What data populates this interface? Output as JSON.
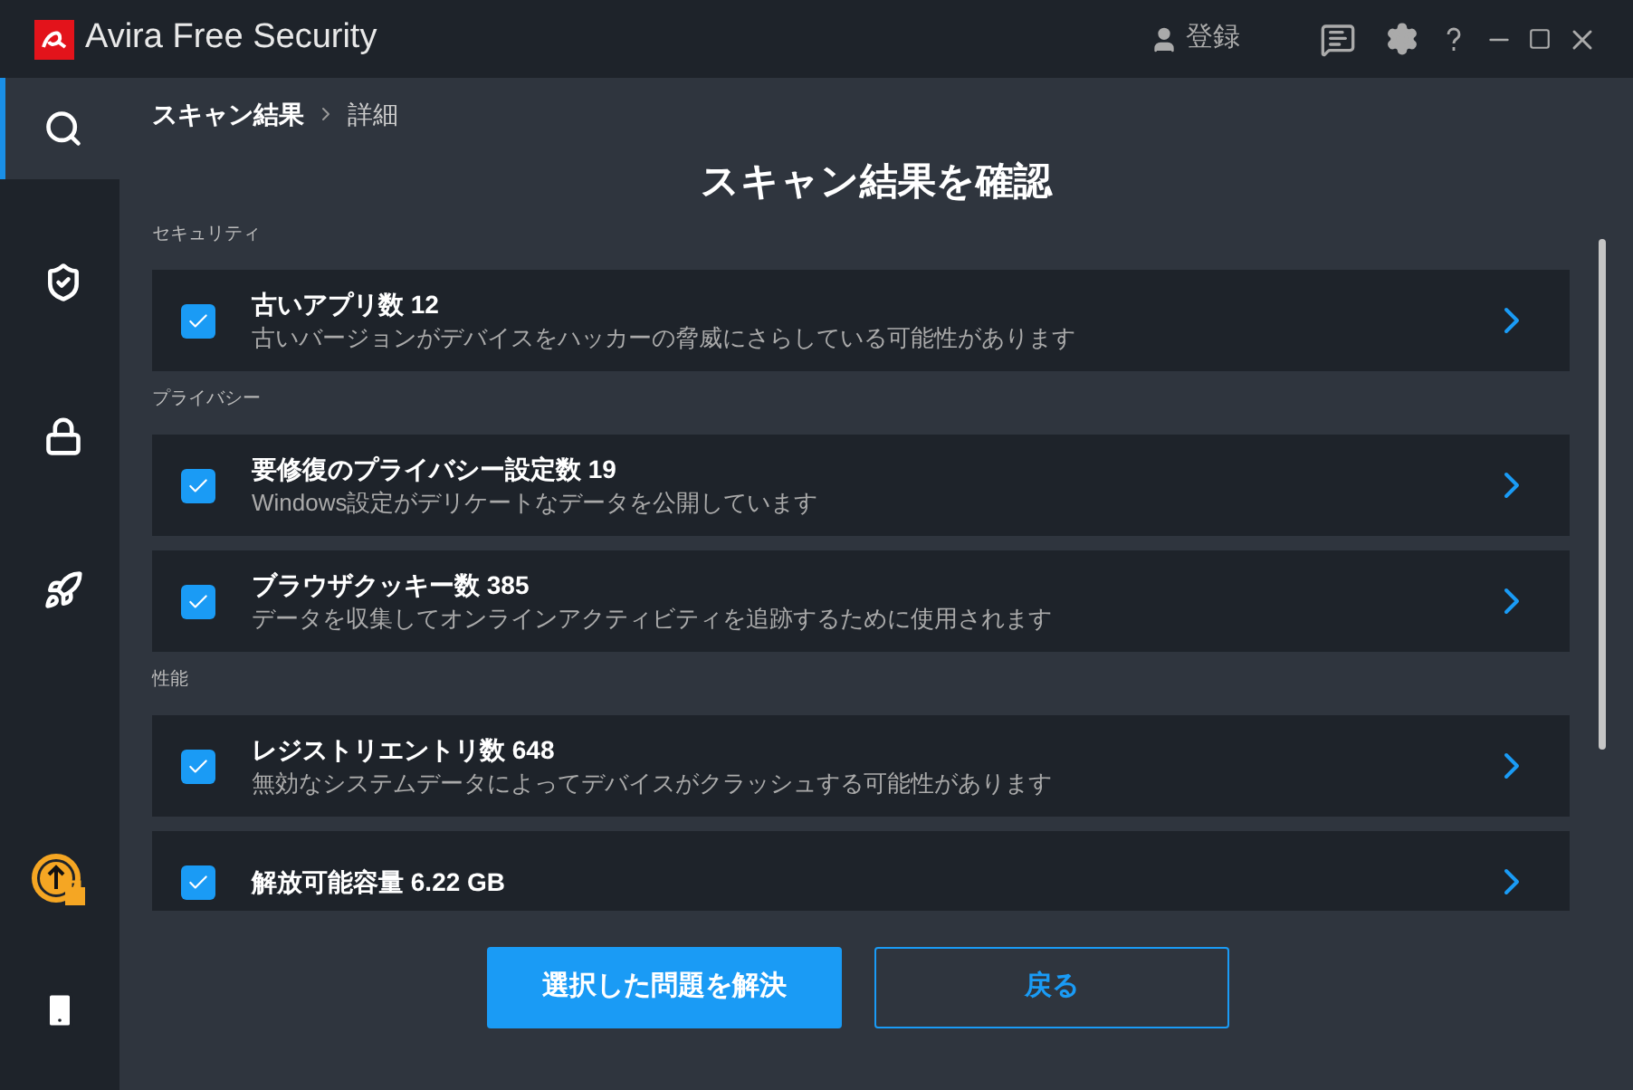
{
  "window": {
    "app_name": "Avira",
    "product": "Free Security",
    "account_label": "登録"
  },
  "sidebar": {
    "items": [
      {
        "selected": true
      },
      {
        "selected": false
      },
      {
        "selected": false
      },
      {
        "selected": false
      }
    ]
  },
  "breadcrumb": [
    "スキャン結果",
    "詳細"
  ],
  "heading": "スキャン結果を確認",
  "sections": [
    {
      "label": "セキュリティ",
      "items": [
        {
          "title": "古いアプリ数 12",
          "description": "古いバージョンがデバイスをハッカーの脅威にさらしている可能性があります",
          "checked": true
        }
      ]
    },
    {
      "label": "プライバシー",
      "items": [
        {
          "title": "要修復のプライバシー設定数 19",
          "description": "Windows設定がデリケートなデータを公開しています",
          "checked": true
        },
        {
          "title": "ブラウザクッキー数 385",
          "description": "データを収集してオンラインアクティビティを追跡するために使用されます",
          "checked": true
        }
      ]
    },
    {
      "label": "性能",
      "items": [
        {
          "title": "レジストリエントリ数 648",
          "description": "無効なシステムデータによってデバイスがクラッシュする可能性があります",
          "checked": true
        },
        {
          "title": "解放可能容量 6.22 GB",
          "checked": true
        }
      ]
    }
  ],
  "buttons": [
    {
      "label": "選択した問題を解決",
      "kind": "primary"
    },
    {
      "label": "戻る",
      "kind": "secondary"
    }
  ]
}
